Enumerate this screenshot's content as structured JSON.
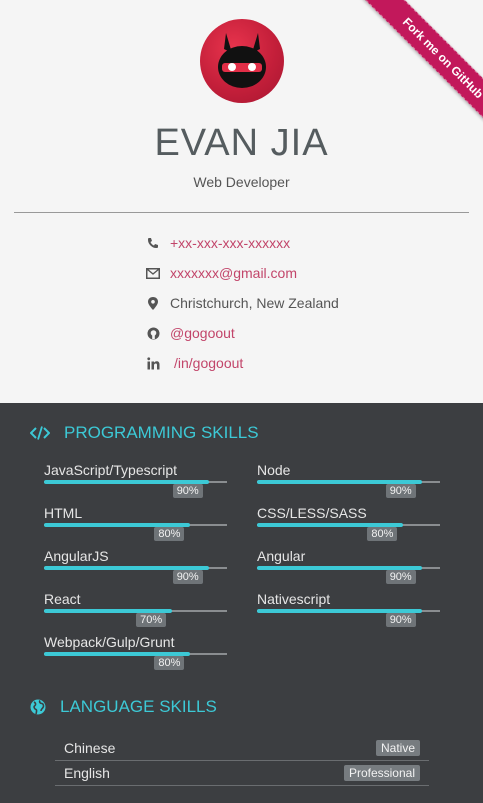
{
  "profile": {
    "name": "EVAN JIA",
    "title": "Web Developer"
  },
  "ribbon": {
    "label": "Fork me on GitHub"
  },
  "contacts": {
    "phone": "+xx-xxx-xxx-xxxxxx",
    "email": "xxxxxxx@gmail.com",
    "location": "Christchurch, New Zealand",
    "github": "@gogoout",
    "linkedin": "/in/gogoout"
  },
  "programming": {
    "title": "PROGRAMMING SKILLS",
    "skills": [
      {
        "name": "JavaScript/Typescript",
        "level": 90,
        "label": "90%"
      },
      {
        "name": "Node",
        "level": 90,
        "label": "90%"
      },
      {
        "name": "HTML",
        "level": 80,
        "label": "80%"
      },
      {
        "name": "CSS/LESS/SASS",
        "level": 80,
        "label": "80%"
      },
      {
        "name": "AngularJS",
        "level": 90,
        "label": "90%"
      },
      {
        "name": "Angular",
        "level": 90,
        "label": "90%"
      },
      {
        "name": "React",
        "level": 70,
        "label": "70%"
      },
      {
        "name": "Nativescript",
        "level": 90,
        "label": "90%"
      },
      {
        "name": "Webpack/Gulp/Grunt",
        "level": 80,
        "label": "80%"
      }
    ]
  },
  "languages": {
    "title": "LANGUAGE SKILLS",
    "items": [
      {
        "name": "Chinese",
        "level": "Native"
      },
      {
        "name": "English",
        "level": "Professional"
      }
    ]
  },
  "colors": {
    "accent": "#3cc9d6",
    "link": "#c2456a",
    "ribbon": "#c2185b",
    "dark_bg": "#3c3e41"
  }
}
